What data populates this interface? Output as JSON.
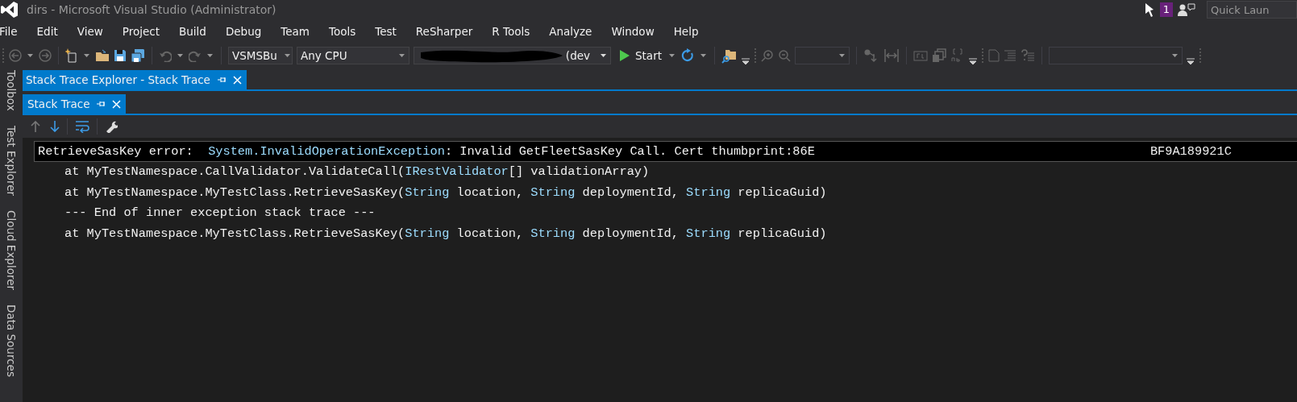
{
  "window": {
    "title": "dirs - Microsoft Visual Studio  (Administrator)",
    "notification_count": "1",
    "quick_launch": {
      "placeholder": "Quick Laun"
    }
  },
  "menu": [
    "File",
    "Edit",
    "View",
    "Project",
    "Build",
    "Debug",
    "Team",
    "Tools",
    "Test",
    "ReSharper",
    "R Tools",
    "Analyze",
    "Window",
    "Help"
  ],
  "toolbar": {
    "solution_platform_1": "VSMSBu",
    "solution_platform": "Any CPU",
    "configuration": "(dev",
    "start": "Start"
  },
  "side_tabs": [
    "Toolbox",
    "Test Explorer",
    "Cloud Explorer",
    "Data Sources"
  ],
  "document_tab": {
    "title": "Stack Trace Explorer - Stack Trace",
    "selected": true
  },
  "inner_tab": {
    "title": "Stack Trace",
    "selected": true
  },
  "trace_lines": [
    {
      "selected": true,
      "indent": false,
      "segments": [
        {
          "kind": "plain",
          "text": "RetrieveSasKey error:  "
        },
        {
          "kind": "type",
          "text": "System.InvalidOperationException"
        },
        {
          "kind": "plain",
          "text": ": Invalid GetFleetSasKey Call. Cert thumbprint:86E"
        },
        {
          "kind": "redaction"
        },
        {
          "kind": "plain",
          "text": "BF9A189921C"
        }
      ]
    },
    {
      "selected": false,
      "indent": true,
      "segments": [
        {
          "kind": "plain",
          "text": "at MyTestNamespace.CallValidator.ValidateCall("
        },
        {
          "kind": "type",
          "text": "IRestValidator"
        },
        {
          "kind": "plain",
          "text": "[] validationArray)"
        }
      ]
    },
    {
      "selected": false,
      "indent": true,
      "segments": [
        {
          "kind": "plain",
          "text": "at MyTestNamespace.MyTestClass.RetrieveSasKey("
        },
        {
          "kind": "type",
          "text": "String"
        },
        {
          "kind": "plain",
          "text": " location, "
        },
        {
          "kind": "type",
          "text": "String"
        },
        {
          "kind": "plain",
          "text": " deploymentId, "
        },
        {
          "kind": "type",
          "text": "String"
        },
        {
          "kind": "plain",
          "text": " replicaGuid)"
        }
      ]
    },
    {
      "selected": false,
      "indent": true,
      "segments": [
        {
          "kind": "plain",
          "text": "--- End of inner exception stack trace ---"
        }
      ]
    },
    {
      "selected": false,
      "indent": true,
      "segments": [
        {
          "kind": "plain",
          "text": "at MyTestNamespace.MyTestClass.RetrieveSasKey("
        },
        {
          "kind": "type",
          "text": "String"
        },
        {
          "kind": "plain",
          "text": " location, "
        },
        {
          "kind": "type",
          "text": "String"
        },
        {
          "kind": "plain",
          "text": " deploymentId, "
        },
        {
          "kind": "type",
          "text": "String"
        },
        {
          "kind": "plain",
          "text": " replicaGuid)"
        }
      ]
    }
  ]
}
